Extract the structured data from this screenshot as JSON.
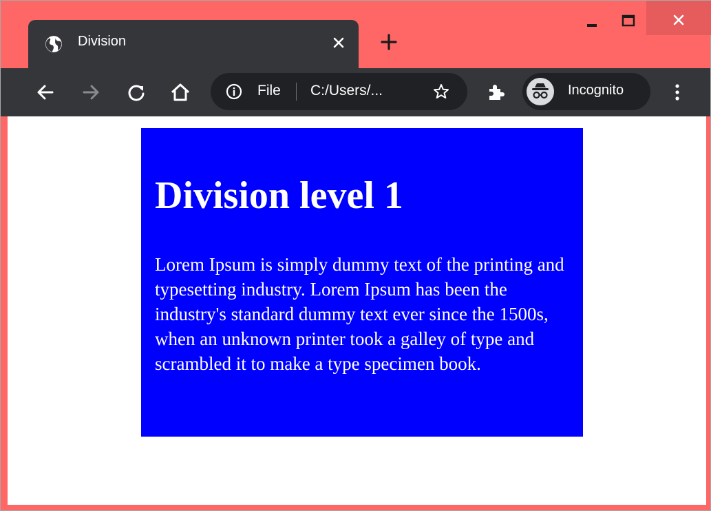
{
  "browser": {
    "tab_title": "Division",
    "omnibox_scheme": "File",
    "omnibox_url": "C:/Users/...",
    "profile_label": "Incognito",
    "frame_color": "#ff6666",
    "toolbar_color": "#35363a"
  },
  "page": {
    "heading": "Division level 1",
    "paragraph": "Lorem Ipsum is simply dummy text of the printing and typesetting industry. Lorem Ipsum has been the industry's standard dummy text ever since the 1500s, when an unknown printer took a galley of type and scrambled it to make a type specimen book.",
    "division_background": "#0000ff",
    "text_color": "#ffffff"
  },
  "icons": [
    "globe-icon",
    "close-icon",
    "plus-icon",
    "minimize-icon",
    "maximize-icon",
    "back-icon",
    "forward-icon",
    "reload-icon",
    "home-icon",
    "info-icon",
    "star-icon",
    "extensions-icon",
    "incognito-icon",
    "more-icon"
  ]
}
